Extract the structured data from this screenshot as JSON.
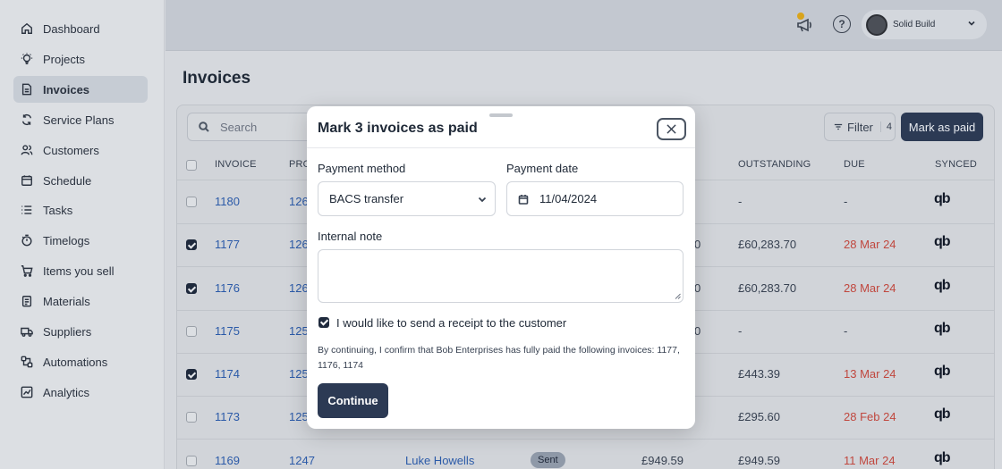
{
  "sidebar": {
    "items": [
      {
        "label": "Dashboard",
        "icon": "home-icon"
      },
      {
        "label": "Projects",
        "icon": "lightbulb-icon"
      },
      {
        "label": "Invoices",
        "icon": "document-icon",
        "active": true
      },
      {
        "label": "Service Plans",
        "icon": "refresh-icon"
      },
      {
        "label": "Customers",
        "icon": "users-icon"
      },
      {
        "label": "Schedule",
        "icon": "calendar-icon"
      },
      {
        "label": "Tasks",
        "icon": "list-icon"
      },
      {
        "label": "Timelogs",
        "icon": "stopwatch-icon"
      },
      {
        "label": "Items you sell",
        "icon": "cart-icon"
      },
      {
        "label": "Materials",
        "icon": "clipboard-icon"
      },
      {
        "label": "Suppliers",
        "icon": "truck-icon"
      },
      {
        "label": "Automations",
        "icon": "automation-icon"
      },
      {
        "label": "Analytics",
        "icon": "chart-icon"
      }
    ]
  },
  "topbar": {
    "account_name": "Solid Build"
  },
  "main": {
    "title": "Invoices",
    "search_placeholder": "Search",
    "filter_label": "Filter",
    "filter_count": "4",
    "mark_paid_label": "Mark as paid",
    "columns": {
      "invoice": "INVOICE",
      "project": "PRO",
      "outstanding": "OUTSTANDING",
      "due": "DUE",
      "synced": "SYNCED"
    },
    "rows": [
      {
        "invoice": "1180",
        "project": "126",
        "amount_tail": "",
        "outstanding": "-",
        "due": "-",
        "due_overdue": false,
        "checked": false
      },
      {
        "invoice": "1177",
        "project": "126",
        "amount_tail": "0",
        "outstanding": "£60,283.70",
        "due": "28 Mar 24",
        "due_overdue": true,
        "checked": true
      },
      {
        "invoice": "1176",
        "project": "126",
        "amount_tail": "0",
        "outstanding": "£60,283.70",
        "due": "28 Mar 24",
        "due_overdue": true,
        "checked": true
      },
      {
        "invoice": "1175",
        "project": "125",
        "amount_tail": "0",
        "outstanding": "-",
        "due": "-",
        "due_overdue": false,
        "checked": false
      },
      {
        "invoice": "1174",
        "project": "125",
        "amount_tail": "",
        "outstanding": "£443.39",
        "due": "13 Mar 24",
        "due_overdue": true,
        "checked": true
      },
      {
        "invoice": "1173",
        "project": "125",
        "amount_tail": "",
        "outstanding": "£295.60",
        "due": "28 Feb 24",
        "due_overdue": true,
        "checked": false
      },
      {
        "invoice": "1169",
        "project": "1247",
        "customer": "Luke Howells",
        "status": "Sent",
        "amount": "£949.59",
        "outstanding": "£949.59",
        "due": "11 Mar 24",
        "due_overdue": true,
        "checked": false
      }
    ],
    "synced_glyph": "qb"
  },
  "modal": {
    "title": "Mark 3 invoices as paid",
    "payment_method_label": "Payment method",
    "payment_method_value": "BACS transfer",
    "payment_date_label": "Payment date",
    "payment_date_value": "11/04/2024",
    "internal_note_label": "Internal note",
    "internal_note_value": "",
    "receipt_label": "I would like to send a receipt to the customer",
    "receipt_checked": true,
    "confirm_text": "By continuing, I confirm that Bob Enterprises has fully paid the following invoices: 1177, 1176, 1174",
    "continue_label": "Continue"
  },
  "colors": {
    "primary": "#2c3a54",
    "link": "#2b5aa8",
    "overdue": "#c0473e"
  }
}
